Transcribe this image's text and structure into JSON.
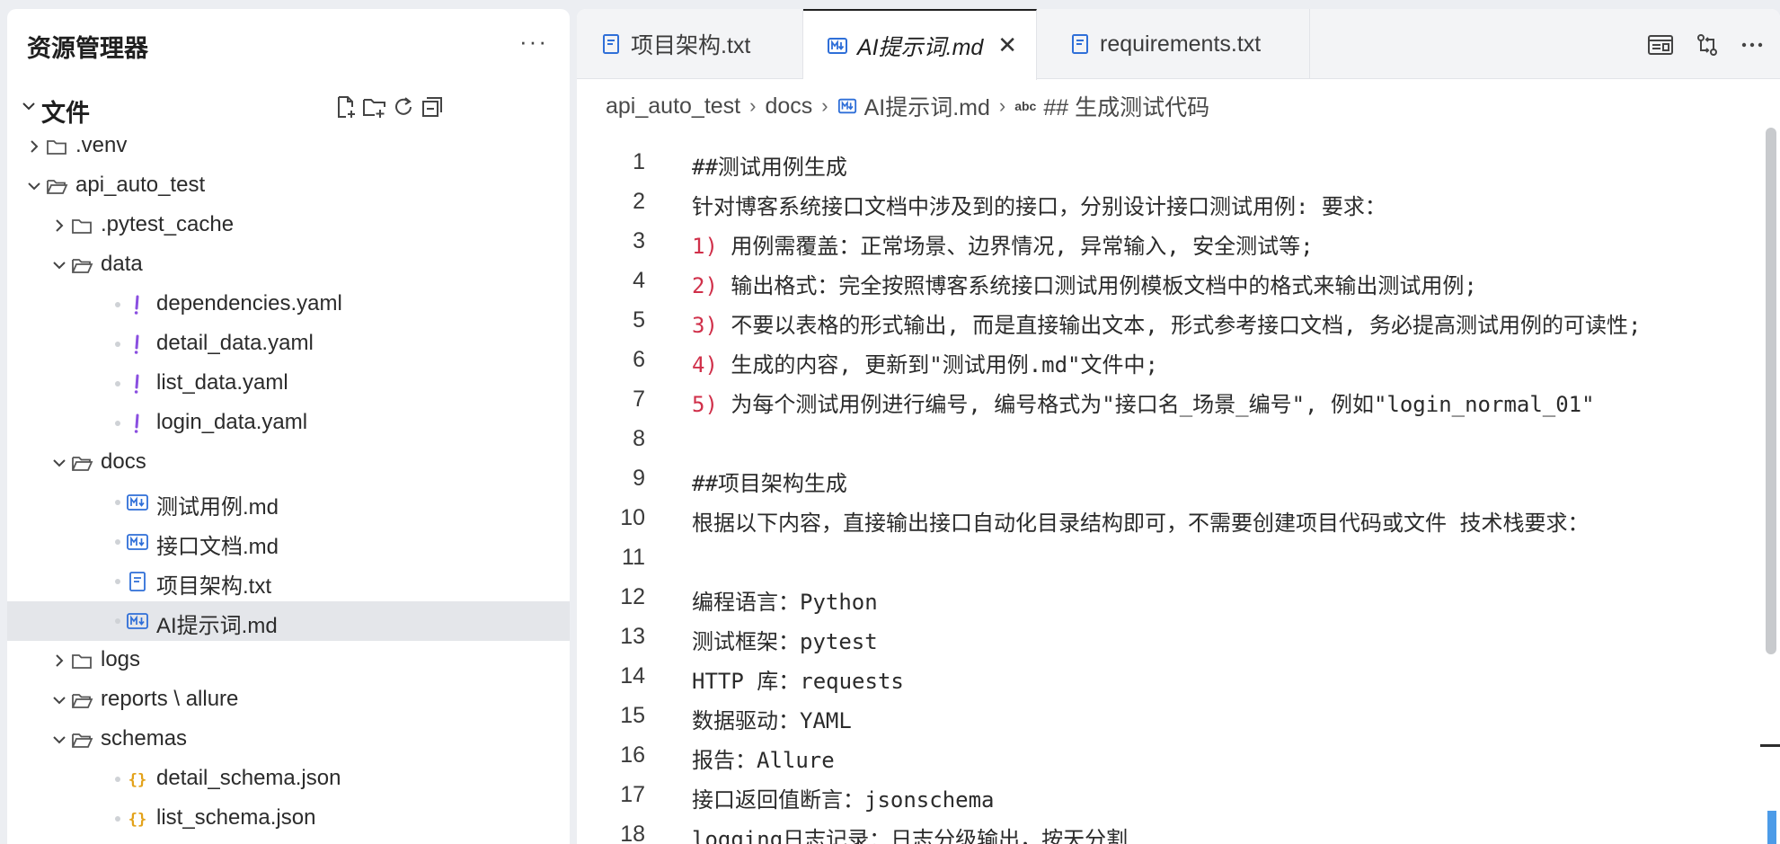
{
  "explorer": {
    "title": "资源管理器",
    "more": "···",
    "section": {
      "title": "文件"
    },
    "items": [
      {
        "label": ".venv",
        "kind": "folder",
        "depth": 0,
        "expanded": false,
        "icon": "folder-icon"
      },
      {
        "label": "api_auto_test",
        "kind": "folder",
        "depth": 0,
        "expanded": true,
        "icon": "folder-open-icon"
      },
      {
        "label": ".pytest_cache",
        "kind": "folder",
        "depth": 1,
        "expanded": false,
        "icon": "folder-icon"
      },
      {
        "label": "data",
        "kind": "folder",
        "depth": 1,
        "expanded": true,
        "icon": "folder-open-icon"
      },
      {
        "label": "dependencies.yaml",
        "kind": "file",
        "depth": 2,
        "icon": "yaml-icon"
      },
      {
        "label": "detail_data.yaml",
        "kind": "file",
        "depth": 2,
        "icon": "yaml-icon"
      },
      {
        "label": "list_data.yaml",
        "kind": "file",
        "depth": 2,
        "icon": "yaml-icon"
      },
      {
        "label": "login_data.yaml",
        "kind": "file",
        "depth": 2,
        "icon": "yaml-icon"
      },
      {
        "label": "docs",
        "kind": "folder",
        "depth": 1,
        "expanded": true,
        "icon": "folder-open-icon"
      },
      {
        "label": "测试用例.md",
        "kind": "file",
        "depth": 2,
        "icon": "markdown-icon"
      },
      {
        "label": "接口文档.md",
        "kind": "file",
        "depth": 2,
        "icon": "markdown-icon"
      },
      {
        "label": "项目架构.txt",
        "kind": "file",
        "depth": 2,
        "icon": "text-file-icon"
      },
      {
        "label": "AI提示词.md",
        "kind": "file",
        "depth": 2,
        "icon": "markdown-icon",
        "selected": true
      },
      {
        "label": "logs",
        "kind": "folder",
        "depth": 1,
        "expanded": false,
        "icon": "folder-icon"
      },
      {
        "label": "reports \\ allure",
        "kind": "folder",
        "depth": 1,
        "expanded": true,
        "icon": "folder-open-icon"
      },
      {
        "label": "schemas",
        "kind": "folder",
        "depth": 1,
        "expanded": true,
        "icon": "folder-open-icon"
      },
      {
        "label": "detail_schema.json",
        "kind": "file",
        "depth": 2,
        "icon": "json-icon"
      },
      {
        "label": "list_schema.json",
        "kind": "file",
        "depth": 2,
        "icon": "json-icon"
      }
    ]
  },
  "tabs": [
    {
      "label": "项目架构.txt",
      "icon": "text-file-icon",
      "active": false
    },
    {
      "label": "AI提示词.md",
      "icon": "markdown-icon",
      "active": true,
      "close": "✕"
    },
    {
      "label": "requirements.txt",
      "icon": "text-file-icon",
      "active": false
    }
  ],
  "breadcrumb": {
    "items": [
      "api_auto_test",
      "docs",
      "AI提示词.md",
      "## 生成测试代码"
    ],
    "abc": "abc"
  },
  "code": {
    "lines": [
      {
        "no": "1",
        "num": "",
        "text": "##测试用例生成"
      },
      {
        "no": "2",
        "num": "",
        "text": "针对博客系统接口文档中涉及到的接口，分别设计接口测试用例: 要求："
      },
      {
        "no": "3",
        "num": "1)",
        "text": " 用例需覆盖：正常场景、边界情况, 异常输入, 安全测试等;"
      },
      {
        "no": "4",
        "num": "2)",
        "text": " 输出格式：完全按照博客系统接口测试用例模板文档中的格式来输出测试用例;"
      },
      {
        "no": "5",
        "num": "3)",
        "text": " 不要以表格的形式输出, 而是直接输出文本, 形式参考接口文档, 务必提高测试用例的可读性;"
      },
      {
        "no": "6",
        "num": "4)",
        "text": " 生成的内容, 更新到\"测试用例.md\"文件中;"
      },
      {
        "no": "7",
        "num": "5)",
        "text": " 为每个测试用例进行编号, 编号格式为\"接口名_场景_编号\", 例如\"login_normal_01\""
      },
      {
        "no": "8",
        "num": "",
        "text": ""
      },
      {
        "no": "9",
        "num": "",
        "text": "##项目架构生成"
      },
      {
        "no": "10",
        "num": "",
        "text": "根据以下内容，直接输出接口自动化目录结构即可，不需要创建项目代码或文件 技术栈要求："
      },
      {
        "no": "11",
        "num": "",
        "text": ""
      },
      {
        "no": "12",
        "num": "",
        "text": "编程语言：Python"
      },
      {
        "no": "13",
        "num": "",
        "text": "测试框架：pytest"
      },
      {
        "no": "14",
        "num": "",
        "text": "HTTP 库：requests"
      },
      {
        "no": "15",
        "num": "",
        "text": "数据驱动：YAML"
      },
      {
        "no": "16",
        "num": "",
        "text": "报告：Allure"
      },
      {
        "no": "17",
        "num": "",
        "text": "接口返回值断言：jsonschema"
      },
      {
        "no": "18",
        "num": "",
        "text": "logging日志记录：日志分级输出，按天分割"
      }
    ]
  },
  "colors": {
    "list_number": "#d0304a",
    "yaml_icon": "#8a4fe0",
    "json_icon": "#e3a21a",
    "markdown_icon": "#2f6fd8",
    "text_icon": "#2f6fd8",
    "selection_bg": "#e4e6ea"
  }
}
